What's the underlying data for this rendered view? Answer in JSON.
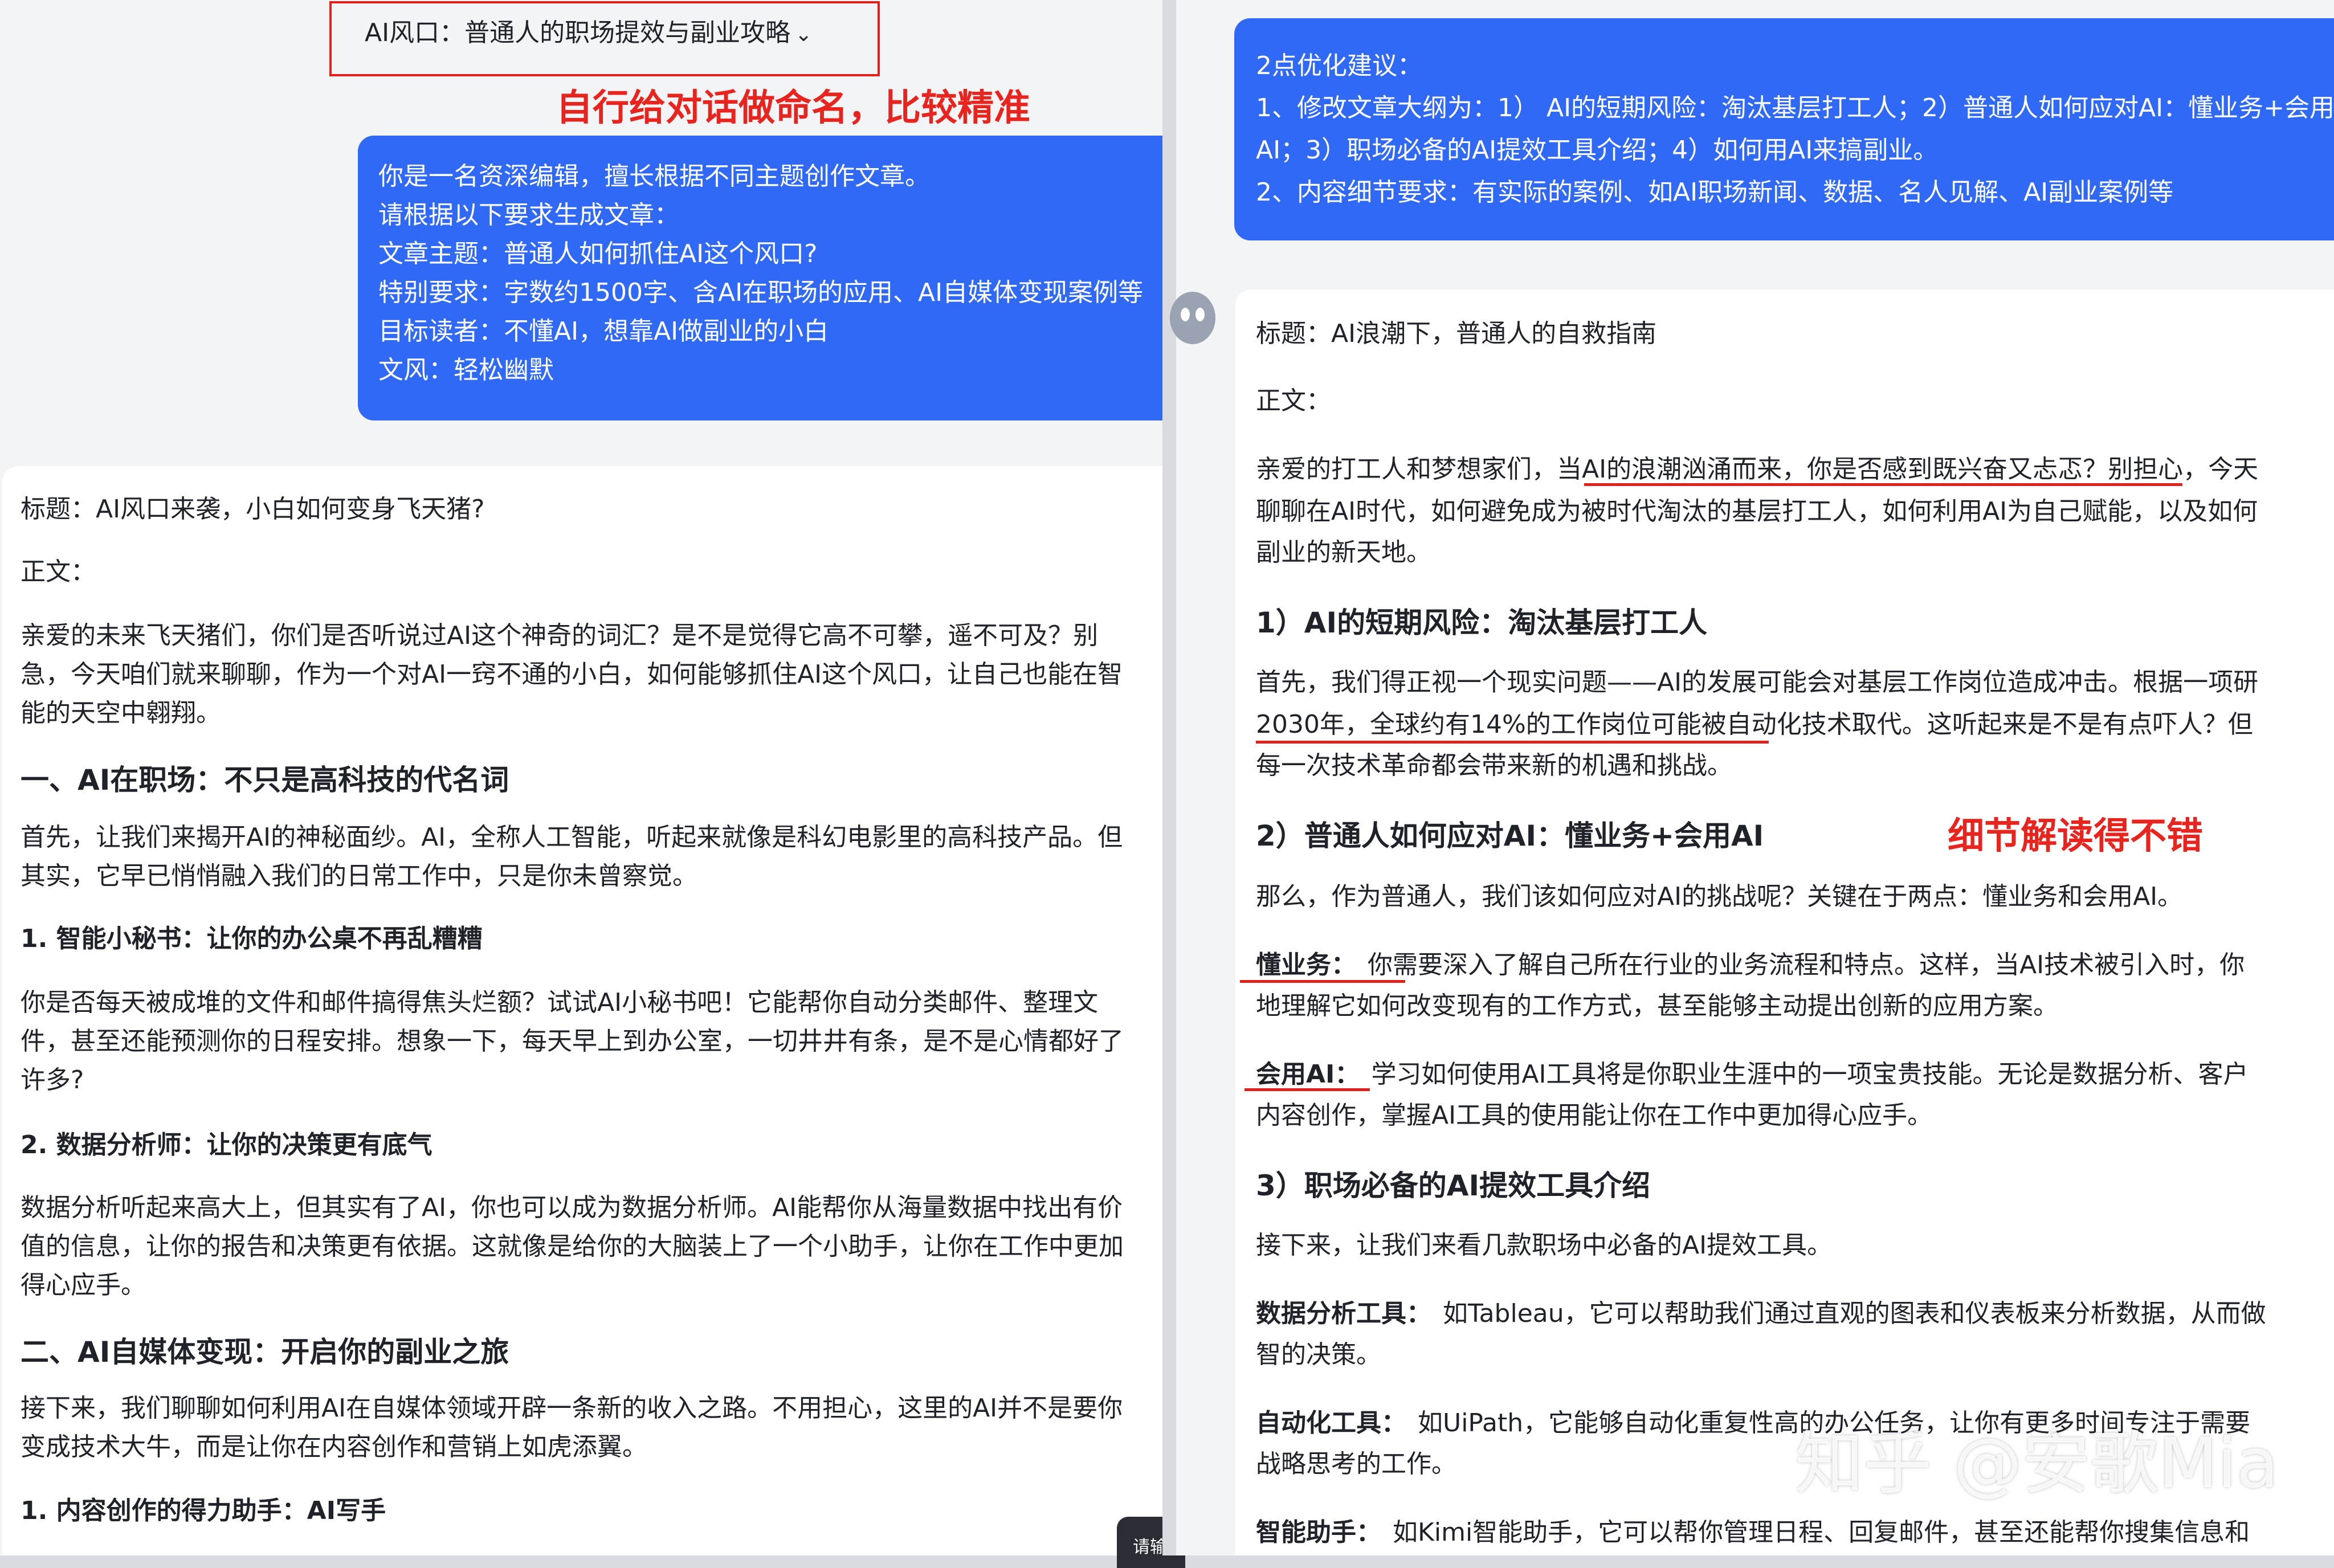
{
  "left": {
    "conversation_title": "AI风口：普通人的职场提效与副业攻略",
    "annotation": "自行给对话做命名，比较精准",
    "prompt_lines": [
      "你是一名资深编辑，擅长根据不同主题创作文章。",
      "请根据以下要求生成文章：",
      "文章主题：普通人如何抓住AI这个风口?",
      "特别要求：字数约1500字、含AI在职场的应用、AI自媒体变现案例等",
      "目标读者：不懂AI，想靠AI做副业的小白",
      "文风：轻松幽默"
    ],
    "response": {
      "title": "标题：AI风口来袭，小白如何变身飞天猪?",
      "body_label": "正文：",
      "intro": [
        "亲爱的未来飞天猪们，你们是否听说过AI这个神奇的词汇？是不是觉得它高不可攀，遥不可及？别",
        "急，今天咱们就来聊聊，作为一个对AI一窍不通的小白，如何能够抓住AI这个风口，让自己也能在智",
        "能的天空中翱翔。"
      ],
      "section1": "一、AI在职场：不只是高科技的代名词",
      "section1_text": [
        "首先，让我们来揭开AI的神秘面纱。AI，全称人工智能，听起来就像是科幻电影里的高科技产品。但",
        "其实，它早已悄悄融入我们的日常工作中，只是你未曾察觉。"
      ],
      "sub1": "1. 智能小秘书：让你的办公桌不再乱糟糟",
      "sub1_text": [
        "你是否每天被成堆的文件和邮件搞得焦头烂额？试试AI小秘书吧！它能帮你自动分类邮件、整理文",
        "件，甚至还能预测你的日程安排。想象一下，每天早上到办公室，一切井井有条，是不是心情都好了",
        "许多?"
      ],
      "sub2": "2. 数据分析师：让你的决策更有底气",
      "sub2_text": [
        "数据分析听起来高大上，但其实有了AI，你也可以成为数据分析师。AI能帮你从海量数据中找出有价",
        "值的信息，让你的报告和决策更有依据。这就像是给你的大脑装上了一个小助手，让你在工作中更加",
        "得心应手。"
      ],
      "section2": "二、AI自媒体变现：开启你的副业之旅",
      "section2_text": [
        "接下来，我们聊聊如何利用AI在自媒体领域开辟一条新的收入之路。不用担心，这里的AI并不是要你",
        "变成技术大牛，而是让你在内容创作和营销上如虎添翼。"
      ],
      "sub3": "1. 内容创作的得力助手：AI写手"
    },
    "send_chip": "请输"
  },
  "right": {
    "prompt_lines": [
      "2点优化建议：",
      "1、修改文章大纲为：1）  AI的短期风险：淘汰基层打工人；2）普通人如何应对AI：懂业务+会用",
      "AI；3）职场必备的AI提效工具介绍；4）如何用AI来搞副业。",
      "2、内容细节要求：有实际的案例、如AI职场新闻、数据、名人见解、AI副业案例等"
    ],
    "annotation": "细节解读得不错",
    "response": {
      "title": "标题：AI浪潮下，普通人的自救指南",
      "body_label": "正文：",
      "intro": [
        "亲爱的打工人和梦想家们，当AI的浪潮汹涌而来，你是否感到既兴奋又忐忑？别担心，今天",
        "聊聊在AI时代，如何避免成为被时代淘汰的基层打工人，如何利用AI为自己赋能，以及如何",
        "副业的新天地。"
      ],
      "h1": "1）AI的短期风险：淘汰基层打工人",
      "h1_text": [
        "首先，我们得正视一个现实问题——AI的发展可能会对基层工作岗位造成冲击。根据一项研",
        "2030年，全球约有14%的工作岗位可能被自动化技术取代。这听起来是不是有点吓人？但",
        "每一次技术革命都会带来新的机遇和挑战。"
      ],
      "h2": "2）普通人如何应对AI：懂业务+会用AI",
      "h2_text": "那么，作为普通人，我们该如何应对AI的挑战呢？关键在于两点：懂业务和会用AI。",
      "p_yewu_label": "懂业务：",
      "p_yewu_text": [
        "你需要深入了解自己所在行业的业务流程和特点。这样，当AI技术被引入时，你",
        "地理解它如何改变现有的工作方式，甚至能够主动提出创新的应用方案。"
      ],
      "p_ai_label": "会用AI：",
      "p_ai_text": [
        "学习如何使用AI工具将是你职业生涯中的一项宝贵技能。无论是数据分析、客户",
        "内容创作，掌握AI工具的使用能让你在工作中更加得心应手。"
      ],
      "h3": "3）职场必备的AI提效工具介绍",
      "h3_text": "接下来，让我们来看几款职场中必备的AI提效工具。",
      "tool1_label": "数据分析工具：",
      "tool1_text": [
        "如Tableau，它可以帮助我们通过直观的图表和仪表板来分析数据，从而做",
        "智的决策。"
      ],
      "tool2_label": "自动化工具：",
      "tool2_text": [
        "如UiPath，它能够自动化重复性高的办公任务，让你有更多时间专注于需要",
        "战略思考的工作。"
      ],
      "tool3_label": "智能助手：",
      "tool3_text": "如Kimi智能助手，它可以帮你管理日程、回复邮件，甚至还能帮你搜集信息和"
    },
    "watermark": "知乎 @安歌Mia"
  },
  "colors": {
    "bubble_blue": "#2f69f5",
    "annotation_red": "#e8241f",
    "background": "#f3f4f6"
  }
}
